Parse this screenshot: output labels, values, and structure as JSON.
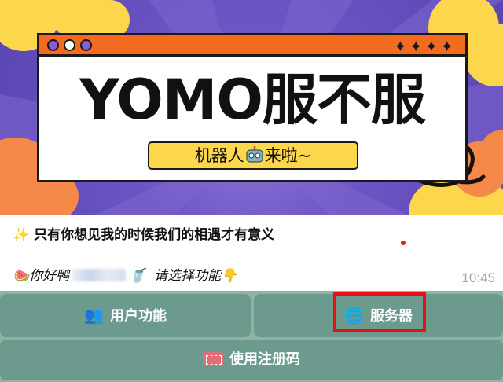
{
  "banner": {
    "title": "YOMO服不服",
    "pill_text_before": "机器人",
    "pill_text_after": "来啦~",
    "stars": "✦✦✦✦"
  },
  "message": {
    "line1_emoji": "✨",
    "line1": "只有你想见我的时候我们的相遇才有意义",
    "line2_emoji_start": "🍉",
    "line2_greeting": "你好鸭",
    "line2_emoji_mid": "🥤",
    "line2_prompt": "请选择功能",
    "line2_emoji_end": "👇",
    "time": "10:45"
  },
  "keyboard": {
    "user_icon": "👥",
    "user_label": "用户功能",
    "server_icon": "🌐",
    "server_label": "服务器",
    "register_label": "使用注册码"
  },
  "colors": {
    "accent_orange": "#f26b1f",
    "pill_yellow": "#fcd64b",
    "highlight_red": "#e81010",
    "button_teal": "#68968c"
  }
}
